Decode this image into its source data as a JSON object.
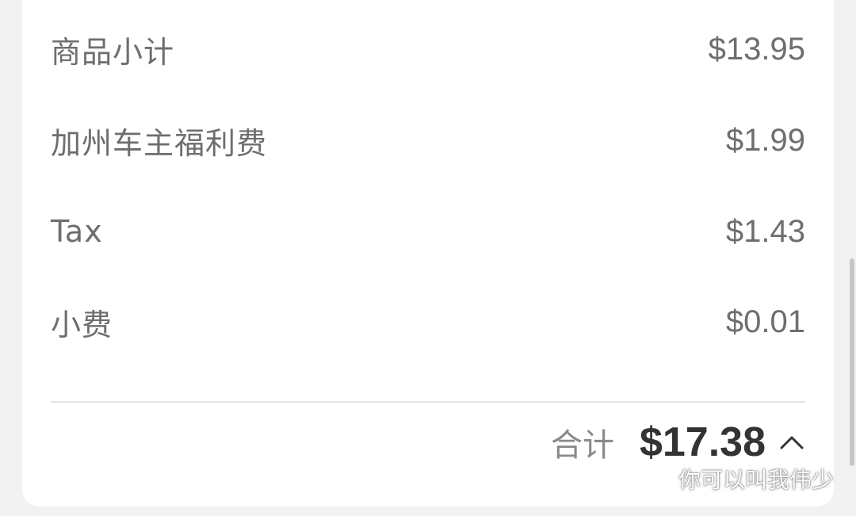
{
  "order_summary": {
    "items": [
      {
        "label": "商品小计",
        "amount": "$13.95"
      },
      {
        "label": "加州车主福利费",
        "amount": "$1.99"
      },
      {
        "label": "Tax",
        "amount": "$1.43"
      },
      {
        "label": "小费",
        "amount": "$0.01"
      }
    ],
    "total_label": "合计",
    "total_amount": "$17.38",
    "expand_icon": "chevron-up-icon"
  },
  "watermark": {
    "icon": "wechat-icon",
    "text": "你可以叫我伟少"
  }
}
